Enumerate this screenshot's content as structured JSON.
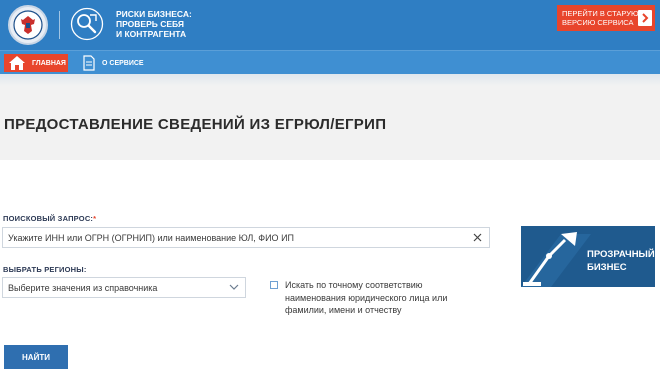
{
  "header": {
    "service_title_lines": [
      "Риски бизнеса:",
      "проверь себя",
      "и контрагента"
    ],
    "old_version_lines": [
      "Перейти в старую",
      "версию сервиса"
    ]
  },
  "nav": {
    "home_label": "Главная",
    "about_label": "О сервисе"
  },
  "page": {
    "title": "Предоставление сведений из ЕГРЮЛ/ЕГРИП"
  },
  "form": {
    "search_label": "Поисковый запрос:",
    "required_mark": "*",
    "search_placeholder": "Укажите ИНН или ОГРН (ОГРНИП) или наименование ЮЛ, ФИО ИП",
    "search_value": "",
    "region_label": "Выбрать регионы:",
    "region_value": "Выберите значения из справочника",
    "exact_match_label": "Искать по точному соответствию наименования юридического лица или фамилии, имени и отчеству",
    "exact_match_checked": false,
    "find_button": "Найти"
  },
  "banner": {
    "lines": [
      "Прозрачный",
      "бизнес"
    ]
  },
  "colors": {
    "header_blue": "#2f7ec3",
    "nav_blue": "#3f8fd2",
    "accent_red": "#e8452c",
    "button_blue": "#2f6fb0",
    "banner_blue": "#1f5a8e"
  },
  "icons": [
    "emblem-icon",
    "service-logo-icon",
    "arrow-right-icon",
    "home-icon",
    "document-icon",
    "clear-icon",
    "chevron-down-icon",
    "lamp-icon"
  ]
}
